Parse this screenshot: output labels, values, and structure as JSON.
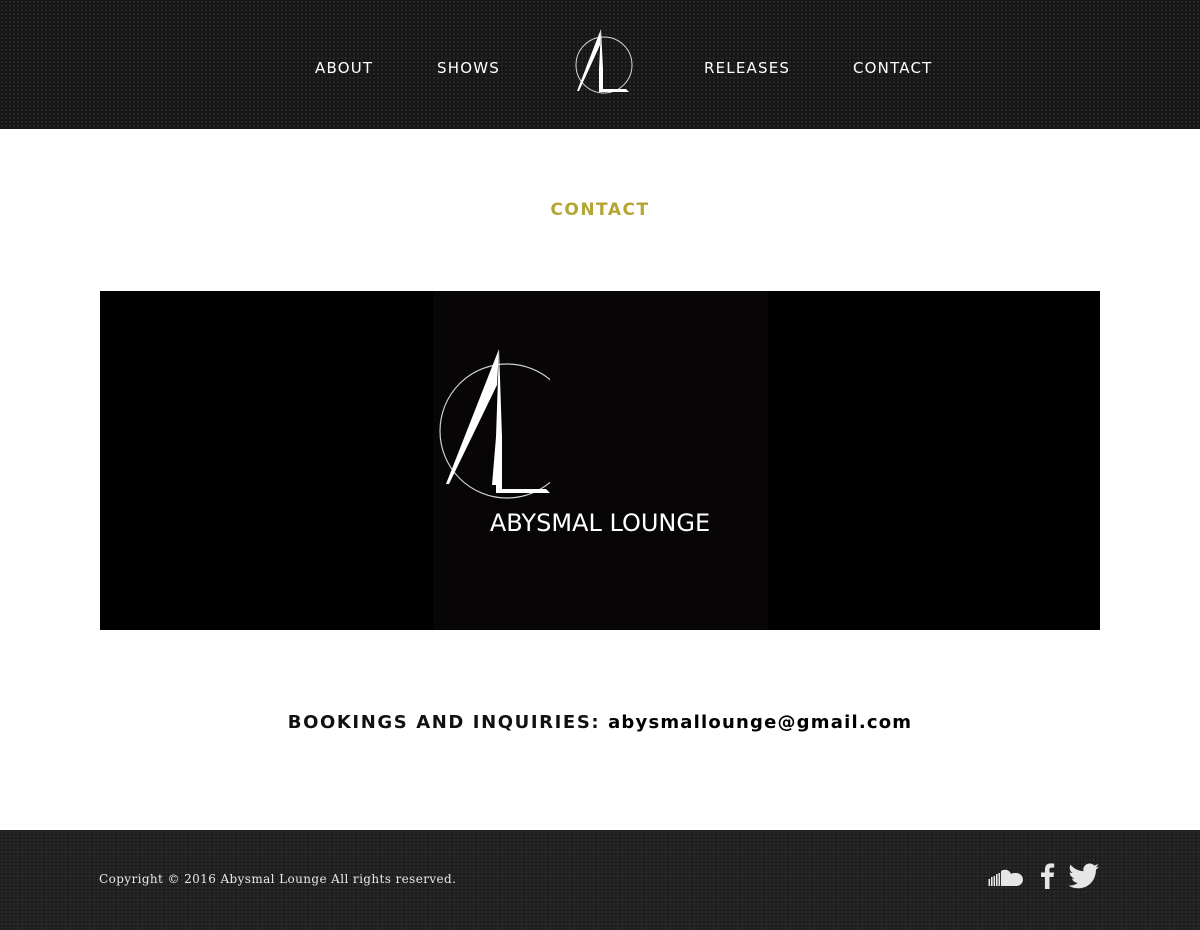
{
  "nav": {
    "items": [
      {
        "label": "ABOUT"
      },
      {
        "label": "SHOWS"
      },
      {
        "label": "RELEASES"
      },
      {
        "label": "CONTACT"
      }
    ],
    "logo_icon": "abysmal-lounge-logo"
  },
  "page": {
    "title": "CONTACT"
  },
  "banner": {
    "brand_name": "ABYSMAL LOUNGE",
    "logo_icon": "abysmal-lounge-logo"
  },
  "contact": {
    "label": "BOOKINGS AND INQUIRIES",
    "separator": ":",
    "email": "abysmallounge@gmail.com"
  },
  "footer": {
    "copyright": "Copyright © 2016 Abysmal Lounge All rights reserved.",
    "social": [
      {
        "icon": "soundcloud-icon"
      },
      {
        "icon": "facebook-icon"
      },
      {
        "icon": "twitter-icon"
      }
    ]
  },
  "colors": {
    "accent": "#b5a534",
    "header_bg": "#1b1b1b",
    "footer_bg": "#242424",
    "banner_bg": "#000000"
  }
}
